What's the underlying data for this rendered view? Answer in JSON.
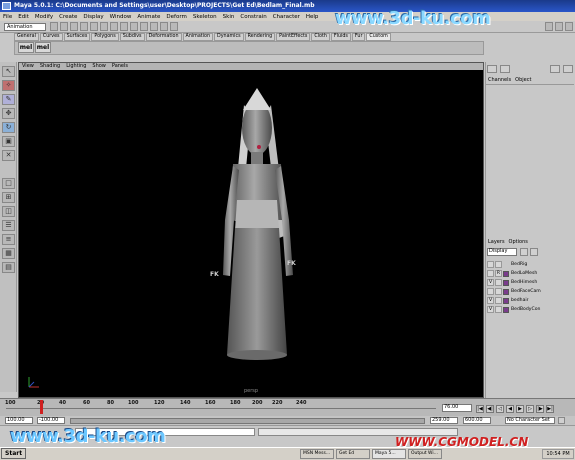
{
  "window": {
    "title": "Maya 5.0.1: C:\\Documents and Settings\\user\\Desktop\\PROJECTS\\Get Ed\\Bedlam_Final.mb"
  },
  "menubar": [
    "File",
    "Edit",
    "Modify",
    "Create",
    "Display",
    "Window",
    "Animate",
    "Deform",
    "Skeleton",
    "Skin",
    "Constrain",
    "Character",
    "Help"
  ],
  "toolbar": {
    "mode": "Animation"
  },
  "shelf": {
    "tabs": [
      "General",
      "Curves",
      "Surfaces",
      "Polygons",
      "Subdivs",
      "Deformation",
      "Animation",
      "Dynamics",
      "Rendering",
      "PaintEffects",
      "Cloth",
      "Fluids",
      "Fur",
      "Custom"
    ],
    "active": "Custom",
    "buttons": [
      "mel",
      "mel"
    ]
  },
  "viewport": {
    "menu": [
      "View",
      "Shading",
      "Lighting",
      "Show",
      "Panels"
    ],
    "labels": {
      "fk_left": "FK",
      "fk_right": "FK",
      "camera": "persp"
    }
  },
  "channelbox": {
    "menu": [
      "Channels",
      "Object"
    ]
  },
  "layers": {
    "menu": [
      "Layers",
      "Options"
    ],
    "display_select": "Display",
    "items": [
      {
        "v": "",
        "p": "",
        "name": "BedRig"
      },
      {
        "v": "",
        "p": "R",
        "name": "BedLoMesh"
      },
      {
        "v": "V",
        "p": "",
        "name": "BedHimesh"
      },
      {
        "v": "",
        "p": "",
        "name": "BedFaceCam"
      },
      {
        "v": "V",
        "p": "",
        "name": "bedhair"
      },
      {
        "v": "V",
        "p": "",
        "name": "BedBodyCon"
      }
    ]
  },
  "timeline": {
    "ticks": [
      "100",
      "20",
      "40",
      "60",
      "80",
      "100",
      "120",
      "140",
      "160",
      "180",
      "200",
      "220",
      "240"
    ],
    "current_frame": "76.00"
  },
  "range": {
    "start": "100.00",
    "start2": "-100.00",
    "end": "259.00",
    "end2": "600.00",
    "character": "No Character Set"
  },
  "taskbar": {
    "start": "Start",
    "items": [
      "MSN Mess...",
      "Get Ed",
      "Maya 5...",
      "Output Wi..."
    ],
    "clock": "10:54 PM"
  },
  "watermarks": {
    "top": "www.3d-ku.com",
    "bottom": "www.3d-ku.com",
    "cg": "WWW.CGMODEL.CN"
  },
  "colors": {
    "layer_swatch": "#7a3c8c",
    "viewport_bg": "#000000",
    "title_bar": "#1a3a8a"
  }
}
